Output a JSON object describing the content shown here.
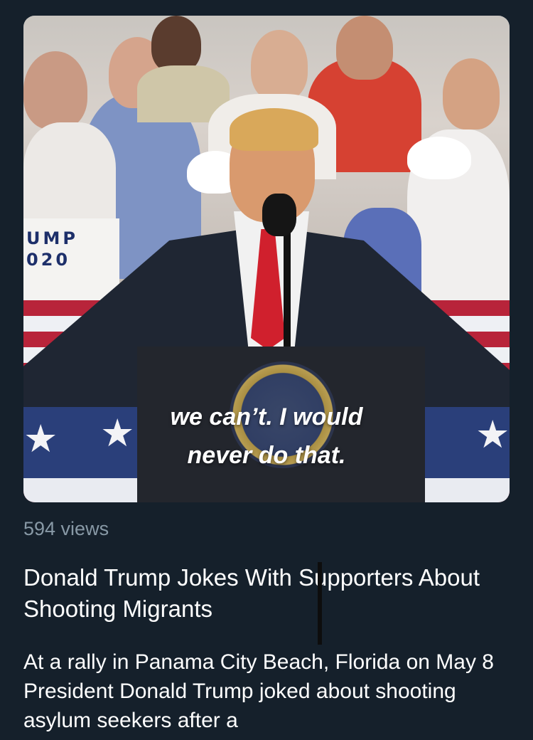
{
  "video": {
    "caption_line1": "we can’t. I would",
    "caption_line2": "never do that.",
    "sign_text_line1": "UMP",
    "sign_text_line2": "020"
  },
  "tweet_card": {
    "views": "594 views",
    "title": "Donald Trump Jokes With Supporters About Shooting Migrants",
    "description": "At a rally in Panama City Beach, Florida on May 8 President Donald Trump joked about shooting asylum seekers after a"
  }
}
